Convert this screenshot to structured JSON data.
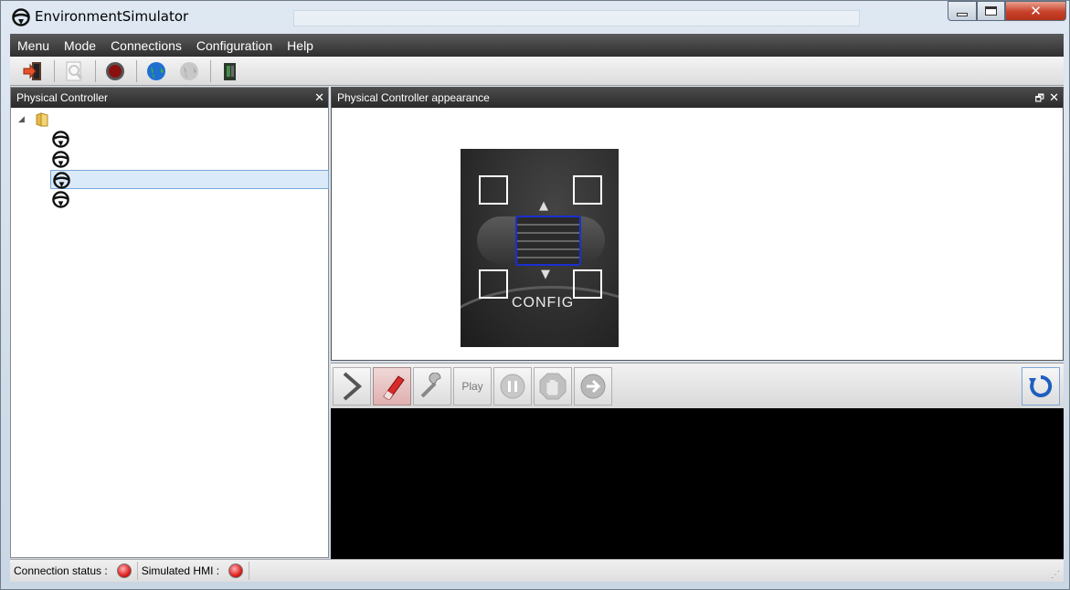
{
  "window": {
    "title": "EnvironmentSimulator",
    "caption_buttons": {
      "minimize": "minimize-icon",
      "maximize": "maximize-icon",
      "close": "✕"
    }
  },
  "menu": [
    "Menu",
    "Mode",
    "Connections",
    "Configuration",
    "Help"
  ],
  "toolbar": {
    "icons": [
      "exit-icon",
      "search-document-icon",
      "record-icon",
      "globe-connect-icon",
      "globe-disconnect-icon",
      "device-icon"
    ]
  },
  "left_panel": {
    "title": "Physical Controller",
    "close": "✕",
    "tree": {
      "root_icon": "folder-icon",
      "children": [
        {
          "icon": "steering-wheel-icon",
          "selected": false
        },
        {
          "icon": "steering-wheel-icon",
          "selected": false
        },
        {
          "icon": "steering-wheel-icon",
          "selected": true
        },
        {
          "icon": "steering-wheel-icon",
          "selected": false
        }
      ]
    }
  },
  "right_panel": {
    "title": "Physical Controller appearance",
    "float": "🗗",
    "close": "✕",
    "controller_image": {
      "label": "CONFIG",
      "highlight_color": "#1a2fd0"
    }
  },
  "playback": {
    "play_label": "Play",
    "icons": [
      "next-chevron-icon",
      "eraser-icon",
      "wrench-icon",
      "play-button",
      "pause-icon",
      "stop-hand-icon",
      "forward-arrow-icon",
      "refresh-icon"
    ]
  },
  "status": {
    "connection_label": "Connection status :",
    "hmi_label": "Simulated HMI :",
    "led_color": "#e02020"
  }
}
